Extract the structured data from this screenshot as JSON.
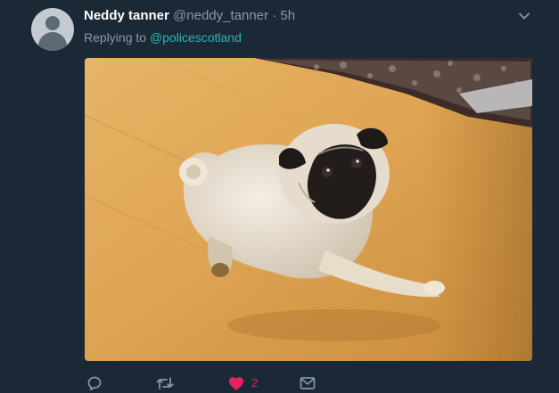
{
  "tweet": {
    "author_name": "Neddy tanner",
    "author_handle": "@neddy_tanner",
    "separator": "·",
    "timestamp": "5h",
    "replying_prefix": "Replying to",
    "replying_to": "@policescotland"
  },
  "media": {
    "kind": "video-frame",
    "subject": "pug-dog"
  },
  "actions": {
    "reply_icon": "reply-icon",
    "retweet_icon": "retweet-icon",
    "like_icon": "heart-icon",
    "like_count": "2",
    "message_icon": "envelope-icon"
  },
  "colors": {
    "background": "#1b2836",
    "muted_text": "#8899a6",
    "mention": "#2fb5b3",
    "like_active": "#e0245e"
  }
}
